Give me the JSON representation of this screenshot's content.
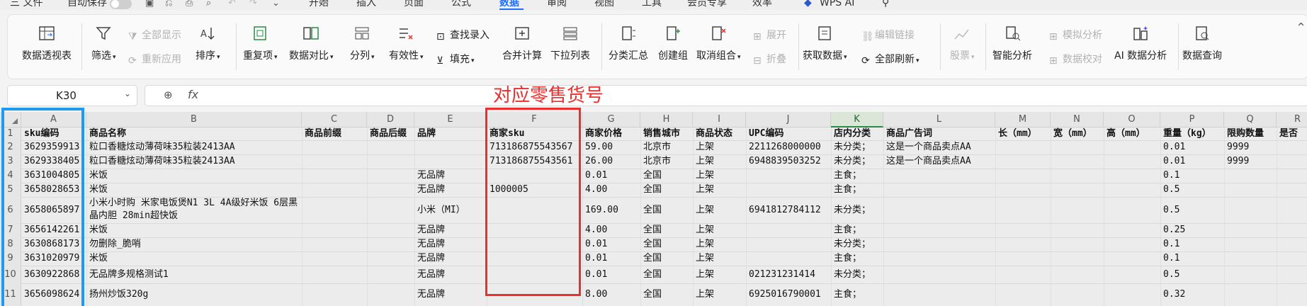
{
  "menubar": {
    "file": "三 文件",
    "autosave": "自动保存",
    "tabs": [
      "开始",
      "插入",
      "页面",
      "公式",
      "数据",
      "审阅",
      "视图",
      "工具",
      "会员专享",
      "效率",
      "WPS AI"
    ],
    "active_tab": "数据"
  },
  "ribbon": {
    "pivot": "数据透视表",
    "filter": "筛选",
    "show_all": "全部显示",
    "reapply": "重新应用",
    "sort": "排序",
    "dup": "重复项",
    "compare": "数据对比",
    "split": "分列",
    "validity": "有效性",
    "lookup": "查找录入",
    "fill": "填充",
    "consolidate": "合并计算",
    "dropdown": "下拉列表",
    "subtotal": "分类汇总",
    "group": "创建组",
    "ungroup": "取消组合",
    "expand": "展开",
    "collapse": "折叠",
    "get_data": "获取数据",
    "edit_links": "编辑链接",
    "refresh_all": "全部刷新",
    "stock": "股票",
    "smart_analysis": "智能分析",
    "simulate": "模拟分析",
    "verify": "数据校对",
    "ai_analysis": "AI 数据分析",
    "data_query": "数据查询"
  },
  "namebox": {
    "value": "K30"
  },
  "formula": {
    "fx": "fx",
    "value": ""
  },
  "annotation": "对应零售货号",
  "grid": {
    "columns": [
      "A",
      "B",
      "C",
      "D",
      "E",
      "F",
      "G",
      "H",
      "I",
      "J",
      "K",
      "L",
      "M",
      "N",
      "O",
      "P",
      "Q",
      "R"
    ],
    "selected_column": "K",
    "row_numbers": [
      "1",
      "2",
      "3",
      "4",
      "5",
      "6",
      "7",
      "8",
      "9",
      "10",
      "11"
    ],
    "header_row": [
      "sku编码",
      "商品名称",
      "商品前缀",
      "商品后缀",
      "品牌",
      "商家sku",
      "商家价格",
      "销售城市",
      "商品状态",
      "UPC编码",
      "店内分类",
      "商品广告词",
      "长（mm）",
      "宽（mm）",
      "高（mm）",
      "重量（kg）",
      "限购数量",
      "是否"
    ],
    "rows": [
      [
        "3629359913",
        "粒口香糖炫动薄荷味35粒装2413AA",
        "",
        "",
        "",
        "713186875543567",
        "59.00",
        "北京市",
        "上架",
        "2211268000000",
        "未分类；",
        "这是一个商品卖点AA",
        "",
        "",
        "",
        "0.01",
        "9999",
        ""
      ],
      [
        "3629338405",
        "粒口香糖炫动薄荷味35粒装2413AA",
        "",
        "",
        "",
        "713186875543561",
        "26.00",
        "北京市",
        "上架",
        "6948839503252",
        "未分类；",
        "这是一个商品卖点AA",
        "",
        "",
        "",
        "0.01",
        "9999",
        ""
      ],
      [
        "3631004805",
        "米饭",
        "",
        "",
        "无品牌",
        "",
        "0.01",
        "全国",
        "上架",
        "",
        "主食；",
        "",
        "",
        "",
        "",
        "0.1",
        "",
        ""
      ],
      [
        "3658028653",
        "米饭",
        "",
        "",
        "无品牌",
        "1000005",
        "4.00",
        "全国",
        "上架",
        "",
        "主食；",
        "",
        "",
        "",
        "",
        "0.5",
        "",
        ""
      ],
      [
        "3658065897",
        "小米小时购 米家电饭煲N1 3L 4A级好米饭 6层黑晶内胆 28min超快饭",
        "",
        "",
        "小米（MI）",
        "",
        "169.00",
        "全国",
        "上架",
        "6941812784112",
        "未分类；",
        "",
        "",
        "",
        "",
        "0.5",
        "",
        ""
      ],
      [
        "3656142261",
        "米饭",
        "",
        "",
        "无品牌",
        "",
        "4.00",
        "全国",
        "上架",
        "",
        "主食；",
        "",
        "",
        "",
        "",
        "0.25",
        "",
        ""
      ],
      [
        "3630868173",
        "勿删除_脆哨",
        "",
        "",
        "无品牌",
        "",
        "0.01",
        "全国",
        "上架",
        "",
        "未分类；",
        "",
        "",
        "",
        "",
        "0.1",
        "",
        ""
      ],
      [
        "3631020979",
        "米饭",
        "",
        "",
        "无品牌",
        "",
        "0.01",
        "全国",
        "上架",
        "",
        "主食；",
        "",
        "",
        "",
        "",
        "0.1",
        "",
        ""
      ],
      [
        "3630922868",
        "无品牌多规格测试1",
        "",
        "",
        "无品牌",
        "",
        "0.01",
        "全国",
        "上架",
        "021231231414",
        "未分类；",
        "",
        "",
        "",
        "",
        "0.5",
        "",
        ""
      ],
      [
        "3656098624",
        "扬州炒饭320g",
        "",
        "",
        "无品牌",
        "",
        "8.00",
        "全国",
        "上架",
        "6925016790001",
        "主食；",
        "",
        "",
        "",
        "",
        "0.32",
        "",
        ""
      ]
    ]
  },
  "colors": {
    "accent": "#1f6fff",
    "annotation_red": "#ee2d2d",
    "highlight_blue": "#1e9af0",
    "selected_col": "#2b8a45"
  }
}
